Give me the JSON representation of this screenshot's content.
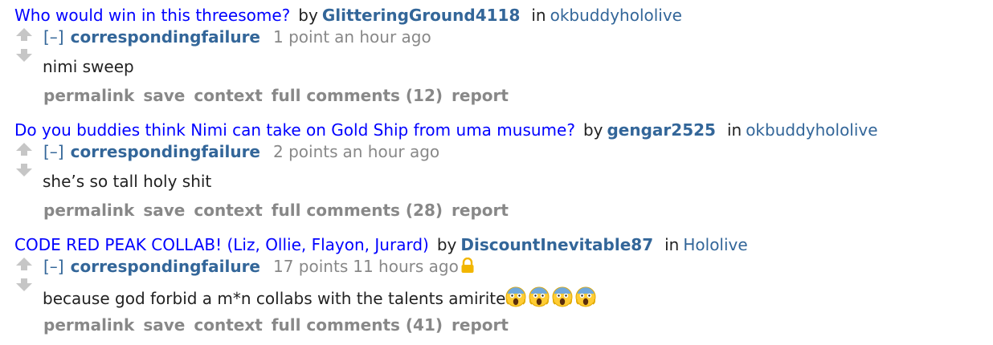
{
  "entries": [
    {
      "post_title": "Who would win in this threesome?",
      "by_label": "by",
      "post_author": "GlitteringGround4118",
      "in_label": "in",
      "subreddit": "okbuddyhololive",
      "collapse_label": "[–]",
      "comment_author": "correspondingfailure",
      "score": "1 point",
      "age": "an hour ago",
      "locked": false,
      "body": "nimi sweep",
      "emojis": [],
      "buttons": [
        "permalink",
        "save",
        "context",
        "full comments (12)",
        "report"
      ]
    },
    {
      "post_title": "Do you buddies think Nimi can take on Gold Ship from uma musume?",
      "by_label": "by",
      "post_author": "gengar2525",
      "in_label": "in",
      "subreddit": "okbuddyhololive",
      "collapse_label": "[–]",
      "comment_author": "correspondingfailure",
      "score": "2 points",
      "age": "an hour ago",
      "locked": false,
      "body": "she’s so tall holy shit",
      "emojis": [],
      "buttons": [
        "permalink",
        "save",
        "context",
        "full comments (28)",
        "report"
      ]
    },
    {
      "post_title": "CODE RED PEAK COLLAB! (Liz, Ollie, Flayon, Jurard)",
      "by_label": "by",
      "post_author": "DiscountInevitable87",
      "in_label": "in",
      "subreddit": "Hololive",
      "collapse_label": "[–]",
      "comment_author": "correspondingfailure",
      "score": "17 points",
      "age": "11 hours ago",
      "locked": true,
      "body": "because god forbid a m*n collabs with the talents amirite",
      "emojis": [
        "screaming-face-emoji",
        "screaming-face-emoji",
        "screaming-face-emoji",
        "screaming-face-emoji"
      ],
      "buttons": [
        "permalink",
        "save",
        "context",
        "full comments (41)",
        "report"
      ]
    }
  ],
  "icons": {
    "vote_up": "up-arrow-icon",
    "vote_down": "down-arrow-icon",
    "lock": "lock-icon",
    "emoji": "screaming-face-emoji"
  },
  "colors": {
    "post_title": "#0000ff",
    "author": "#336699",
    "muted": "#888888",
    "text": "#222222",
    "arrow": "#c6c6c6",
    "lock": "#f2b600"
  }
}
